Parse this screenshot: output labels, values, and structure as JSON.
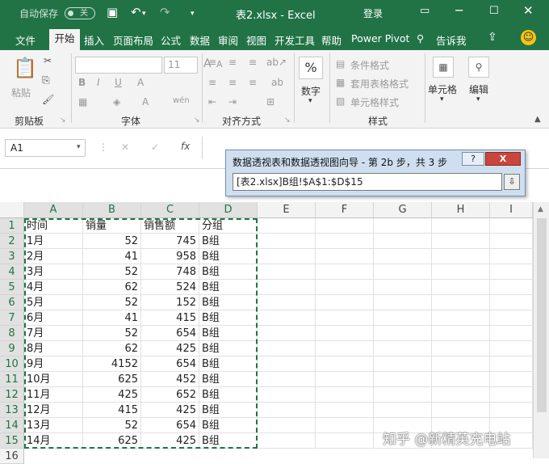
{
  "titlebar": {
    "autosave": "自动保存",
    "toggle": "关",
    "title": "表2.xlsx  -  Excel",
    "login": "登录"
  },
  "tabs": [
    "文件",
    "开始",
    "插入",
    "页面布局",
    "公式",
    "数据",
    "审阅",
    "视图",
    "开发工具",
    "帮助",
    "Power Pivot"
  ],
  "tell_me": "告诉我",
  "ribbon": {
    "paste": "粘贴",
    "clipboard": "剪贴板",
    "font": "字体",
    "font_size": "11",
    "font_grow": "A",
    "font_shrink": "A",
    "bold": "B",
    "italic": "I",
    "underline": "U",
    "alignment": "对齐方式",
    "wrap": "ab",
    "number_pct": "%",
    "number": "数字",
    "cond_format": "条件格式",
    "table_format": "套用表格格式",
    "cell_style": "单元格样式",
    "styles": "样式",
    "cells": "单元格",
    "editing": "编辑"
  },
  "formula_bar": {
    "name_box": "A1",
    "cancel": "✕",
    "enter": "✓",
    "fx": "fx"
  },
  "dialog": {
    "title": "数据透视表和数据透视图向导 - 第 2b 步，共 3 步",
    "help": "?",
    "close": "X",
    "ref": "[表2.xlsx]B组!$A$1:$D$15"
  },
  "columns": [
    "A",
    "B",
    "C",
    "D",
    "E",
    "F",
    "G",
    "H",
    "I"
  ],
  "rows": [
    [
      "时间",
      "销量",
      "销售额",
      "分组"
    ],
    [
      "1月",
      "52",
      "745",
      "B组"
    ],
    [
      "2月",
      "41",
      "958",
      "B组"
    ],
    [
      "3月",
      "52",
      "748",
      "B组"
    ],
    [
      "4月",
      "62",
      "524",
      "B组"
    ],
    [
      "5月",
      "52",
      "152",
      "B组"
    ],
    [
      "6月",
      "41",
      "415",
      "B组"
    ],
    [
      "7月",
      "52",
      "654",
      "B组"
    ],
    [
      "8月",
      "62",
      "425",
      "B组"
    ],
    [
      "9月",
      "4152",
      "654",
      "B组"
    ],
    [
      "10月",
      "625",
      "452",
      "B组"
    ],
    [
      "11月",
      "425",
      "652",
      "B组"
    ],
    [
      "12月",
      "415",
      "425",
      "B组"
    ],
    [
      "13月",
      "52",
      "654",
      "B组"
    ],
    [
      "14月",
      "625",
      "425",
      "B组"
    ]
  ],
  "watermark": "知乎 @新精英充电站",
  "colors": {
    "excel_green": "#217346",
    "ribbon_bg": "#f3f3f3",
    "dialog_bg": "#cfdff0",
    "close_red": "#c9463d"
  }
}
